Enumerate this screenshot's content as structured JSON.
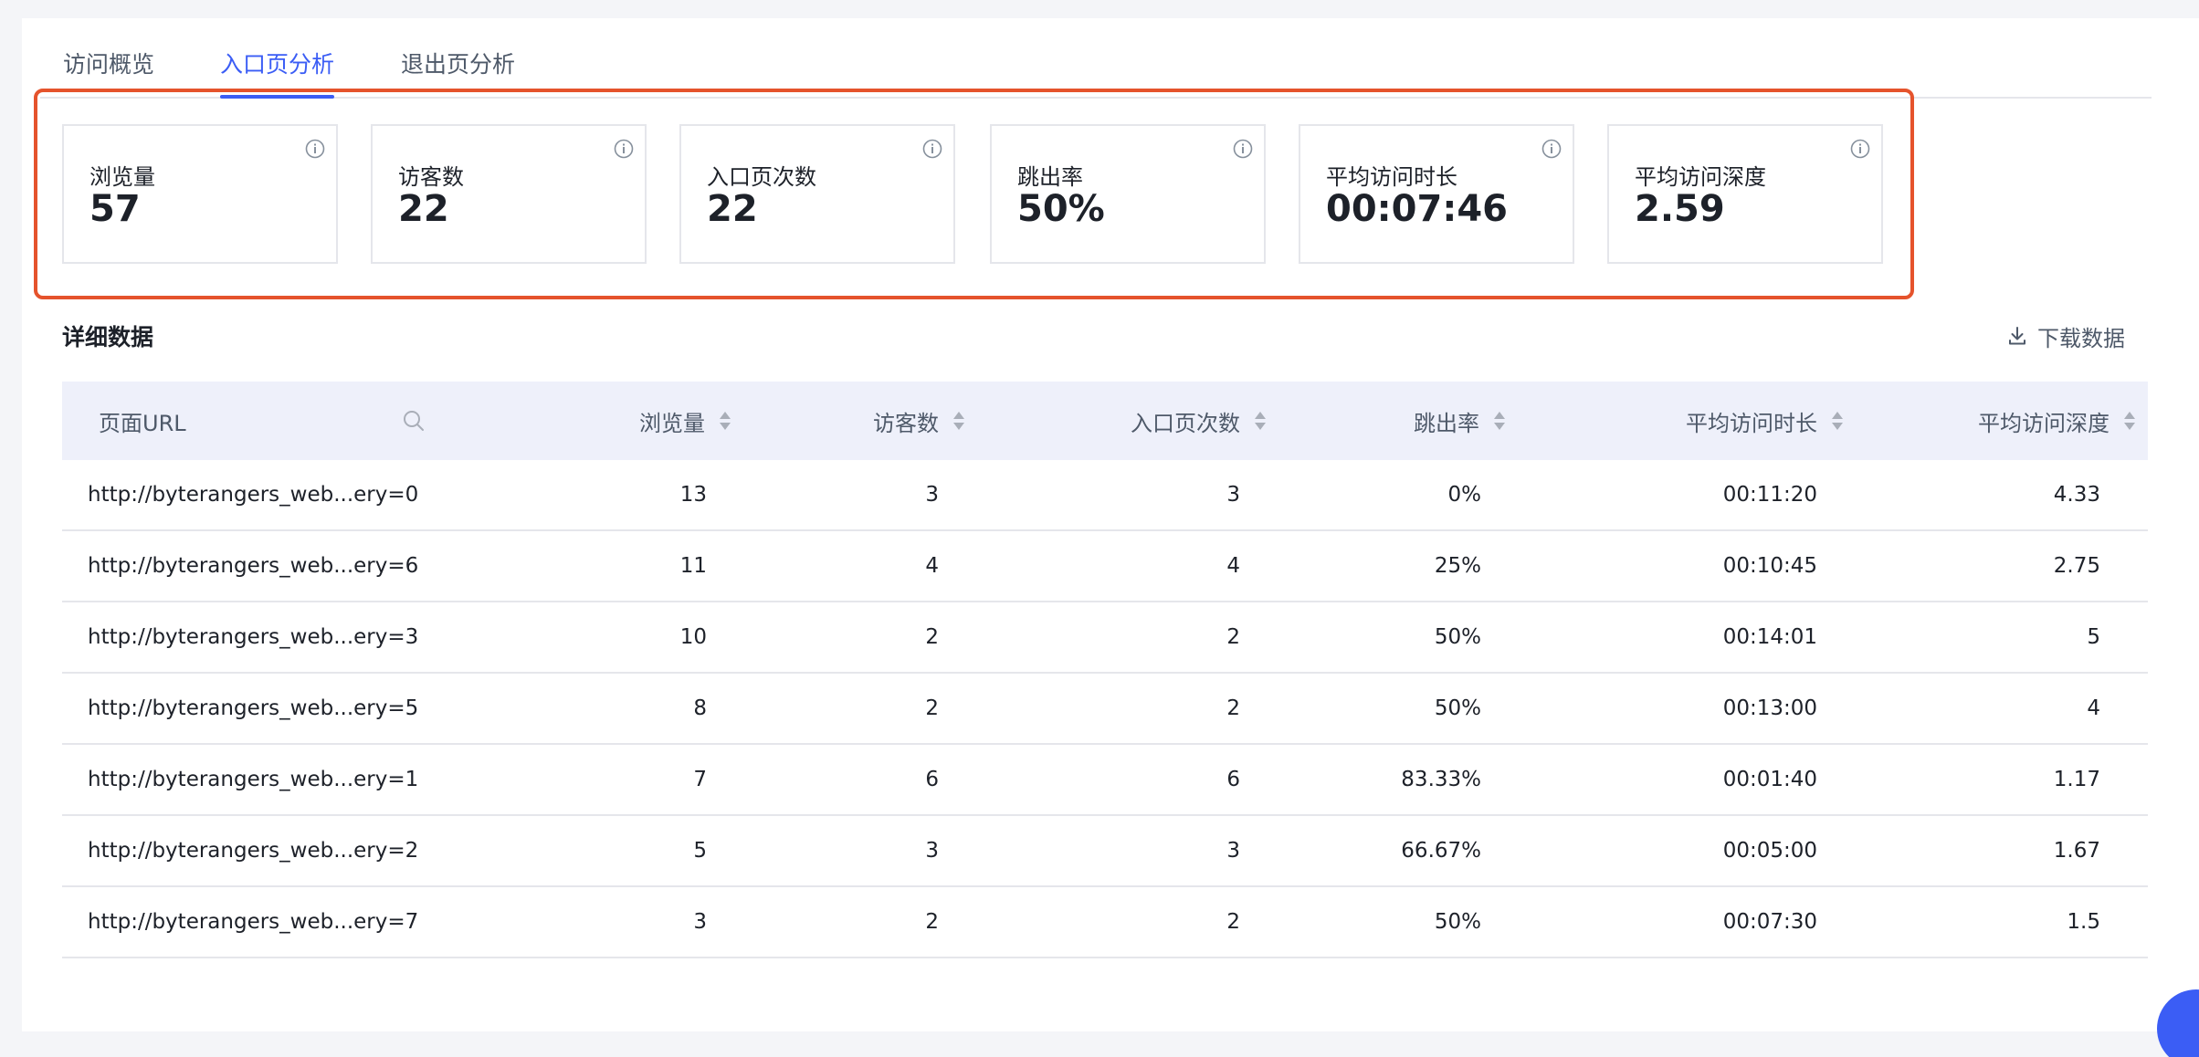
{
  "tabs": [
    {
      "label": "访问概览",
      "active": false
    },
    {
      "label": "入口页分析",
      "active": true
    },
    {
      "label": "退出页分析",
      "active": false
    }
  ],
  "metrics": [
    {
      "label": "浏览量",
      "value": "57"
    },
    {
      "label": "访客数",
      "value": "22"
    },
    {
      "label": "入口页次数",
      "value": "22"
    },
    {
      "label": "跳出率",
      "value": "50%"
    },
    {
      "label": "平均访问时长",
      "value": "00:07:46"
    },
    {
      "label": "平均访问深度",
      "value": "2.59"
    }
  ],
  "details": {
    "title": "详细数据",
    "download_label": "下载数据"
  },
  "table": {
    "columns": [
      "页面URL",
      "浏览量",
      "访客数",
      "入口页次数",
      "跳出率",
      "平均访问时长",
      "平均访问深度"
    ],
    "rows": [
      [
        "http://byterangers_web...ery=0",
        "13",
        "3",
        "3",
        "0%",
        "00:11:20",
        "4.33"
      ],
      [
        "http://byterangers_web...ery=6",
        "11",
        "4",
        "4",
        "25%",
        "00:10:45",
        "2.75"
      ],
      [
        "http://byterangers_web...ery=3",
        "10",
        "2",
        "2",
        "50%",
        "00:14:01",
        "5"
      ],
      [
        "http://byterangers_web...ery=5",
        "8",
        "2",
        "2",
        "50%",
        "00:13:00",
        "4"
      ],
      [
        "http://byterangers_web...ery=1",
        "7",
        "6",
        "6",
        "83.33%",
        "00:01:40",
        "1.17"
      ],
      [
        "http://byterangers_web...ery=2",
        "5",
        "3",
        "3",
        "66.67%",
        "00:05:00",
        "1.67"
      ],
      [
        "http://byterangers_web...ery=7",
        "3",
        "2",
        "2",
        "50%",
        "00:07:30",
        "1.5"
      ]
    ]
  },
  "colors": {
    "accent": "#3b5df5",
    "highlight": "#e5532c",
    "header_bg": "#eef0fa"
  }
}
